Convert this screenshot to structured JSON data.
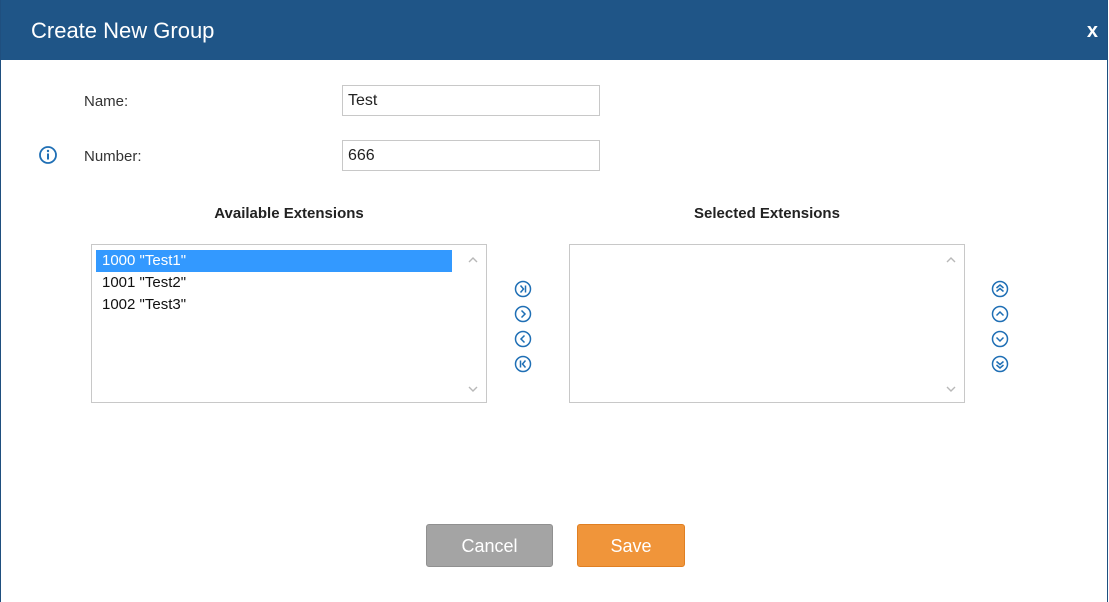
{
  "dialog": {
    "title": "Create New Group",
    "close_label": "x"
  },
  "form": {
    "name_label": "Name:",
    "name_value": "Test",
    "number_label": "Number:",
    "number_value": "666"
  },
  "available": {
    "heading": "Available Extensions",
    "items": [
      "1000 \"Test1\"",
      "1001 \"Test2\"",
      "1002 \"Test3\""
    ],
    "selected_index": 0
  },
  "selected": {
    "heading": "Selected Extensions",
    "items": []
  },
  "icons": {
    "info": "info-icon",
    "move_all_right": "double-chevron-right-icon",
    "move_right": "chevron-right-icon",
    "move_left": "chevron-left-icon",
    "move_all_left": "double-chevron-left-icon",
    "move_top": "double-chevron-up-icon",
    "move_up": "chevron-up-icon",
    "move_down": "chevron-down-icon",
    "move_bottom": "double-chevron-down-icon"
  },
  "buttons": {
    "cancel": "Cancel",
    "save": "Save"
  },
  "colors": {
    "titlebar": "#1f5587",
    "accent": "#1f6fb5",
    "selection": "#3399ff",
    "save": "#f0953a",
    "cancel": "#a4a4a4"
  }
}
